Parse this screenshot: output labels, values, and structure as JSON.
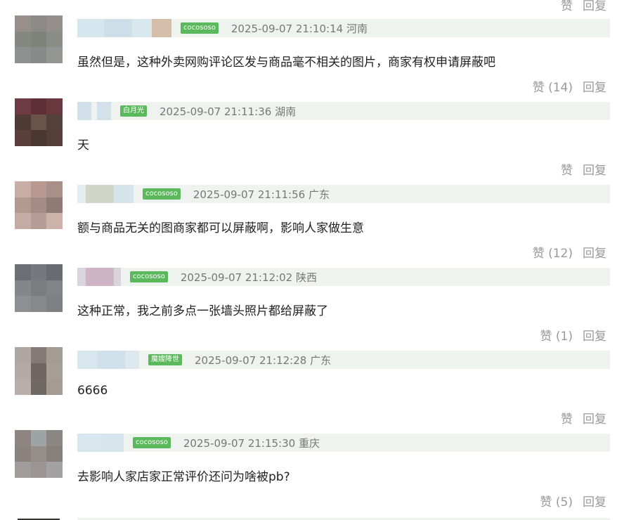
{
  "top_actions": {
    "like_label": "赞",
    "reply_label": "回复"
  },
  "comments": [
    {
      "badge": "cocososo",
      "meta": "2025-09-07 21:10:14 河南",
      "content": "虽然但是，这种外卖网购评论区发与商品毫不相关的图片，商家有权申请屏蔽吧",
      "like_label": "赞 (14)",
      "reply_label": "回复",
      "avatar_colors": [
        "#9a8e8a",
        "#8c8a86",
        "#948e8c",
        "#858880",
        "#7d827b",
        "#8a8d87",
        "#8f9090",
        "#868a88",
        "#939693"
      ],
      "name_colors": [
        "#d6e6ee",
        "#cde0ea",
        "#d9e7ee",
        "#d4beaa"
      ]
    },
    {
      "badge": "白月光",
      "meta": "2025-09-07 21:11:36 湖南",
      "content": "天",
      "like_label": "赞",
      "reply_label": "回复",
      "avatar_colors": [
        "#6e3a44",
        "#5e2f36",
        "#6a3940",
        "#4f3a35",
        "#6a5347",
        "#54413c",
        "#5b3f3a",
        "#4a3732",
        "#553d38"
      ],
      "name_colors": [
        "#d0dfe8",
        "#eef3f0",
        "#d3e2ea"
      ]
    },
    {
      "badge": "cocososo",
      "meta": "2025-09-07 21:11:56 广东",
      "content": "额与商品无关的图商家都可以屏蔽啊，影响人家做生意",
      "like_label": "赞 (12)",
      "reply_label": "回复",
      "avatar_colors": [
        "#c9aea5",
        "#b8988f",
        "#a88f88",
        "#b39a90",
        "#a48b84",
        "#8f7a74",
        "#c6aba4",
        "#b69c95",
        "#cdb2aa"
      ],
      "name_colors": [
        "#e3eef0",
        "#d2d6c9",
        "#d5e4e8"
      ]
    },
    {
      "badge": "cocososo",
      "meta": "2025-09-07 21:12:02 陕西",
      "content": "这种正常，我之前多点一张墙头照片都给屏蔽了",
      "like_label": "赞 (1)",
      "reply_label": "回复",
      "avatar_colors": [
        "#6d6e73",
        "#77787d",
        "#6a6b70",
        "#85868a",
        "#7b7c80",
        "#828387",
        "#8e8f93",
        "#87888c",
        "#7f8084"
      ],
      "name_colors": [
        "#d8d6dc",
        "#cfb5c3",
        "#d9d4db"
      ]
    },
    {
      "badge": "魔嫂降世",
      "meta": "2025-09-07 21:12:28 广东",
      "content": "6666",
      "like_label": "赞",
      "reply_label": "回复",
      "avatar_colors": [
        "#b0a6a0",
        "#857a75",
        "#a59b95",
        "#b5aaa3",
        "#706661",
        "#a89e98",
        "#b9aea8",
        "#6f6863",
        "#a59a94"
      ],
      "name_colors": [
        "#d8e6ee",
        "#cfe0ea",
        "#dce8ee"
      ]
    },
    {
      "badge": "cocososo",
      "meta": "2025-09-07 21:15:30 重庆",
      "content": "去影响人家店家正常评价还问为啥被pb?",
      "like_label": "赞 (5)",
      "reply_label": "回复",
      "avatar_colors": [
        "#8f8580",
        "#9ea3a5",
        "#8a8682",
        "#8b827e",
        "#958d88",
        "#877f7a",
        "#a09c9c",
        "#9a9493",
        "#a3a1a2"
      ],
      "name_colors": [
        "#d8e6ee",
        "#d6e4ec"
      ]
    }
  ]
}
